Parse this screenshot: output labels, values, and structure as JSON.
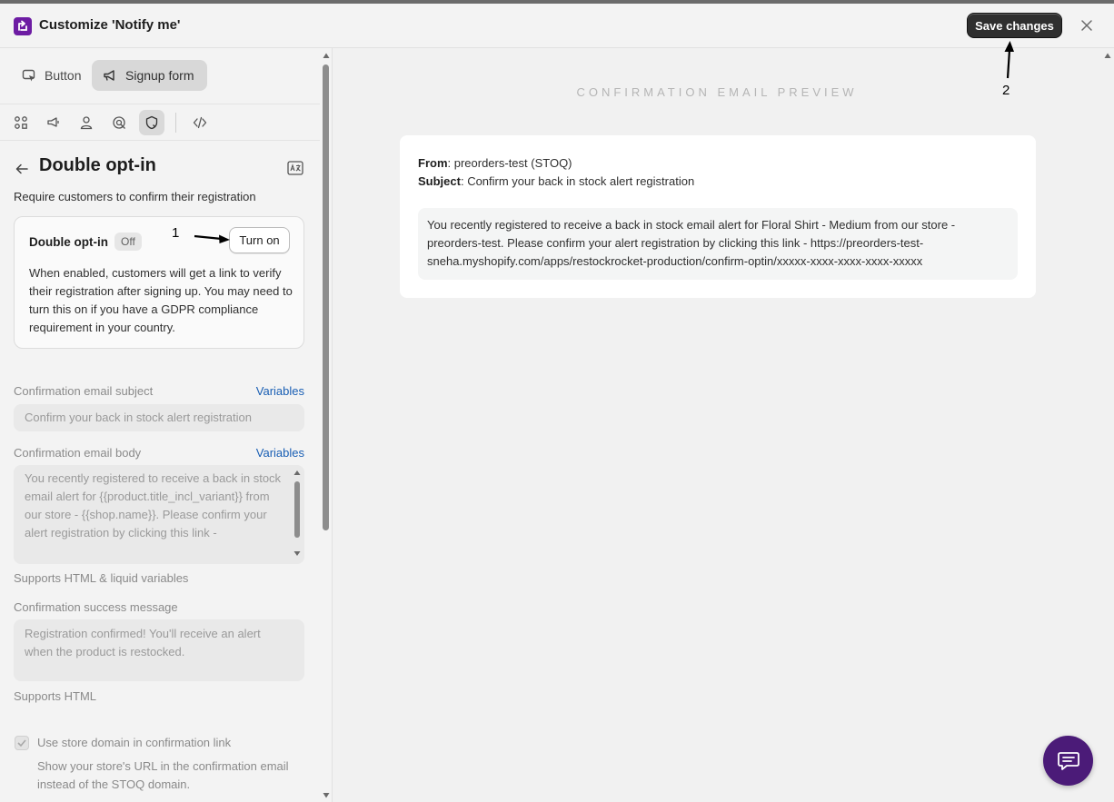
{
  "header": {
    "title": "Customize 'Notify me'",
    "save_label": "Save changes",
    "app_logo_icon": "app-logo-icon",
    "close_icon": "close-icon"
  },
  "left_panel": {
    "tabs": [
      {
        "label": "Button",
        "icon": "cursor-click-icon",
        "active": false
      },
      {
        "label": "Signup form",
        "icon": "megaphone-icon",
        "active": true
      }
    ],
    "section_icons": [
      "layout-blocks-icon",
      "megaphone-icon",
      "person-icon",
      "target-icon",
      "shield-icon",
      "code-icon"
    ],
    "active_section_icon": "shield-icon",
    "section": {
      "title": "Double opt-in",
      "subtitle": "Require customers to confirm their registration",
      "translate_icon": "translate-icon"
    },
    "double_optin_card": {
      "label": "Double opt-in",
      "status_badge": "Off",
      "turn_on_label": "Turn on",
      "description": "When enabled, customers will get a link to verify their registration after signing up. You may need to turn this on if you have a GDPR compliance requirement in your country."
    },
    "subject_field": {
      "label": "Confirmation email subject",
      "variables_link": "Variables",
      "value": "Confirm your back in stock alert registration"
    },
    "body_field": {
      "label": "Confirmation email body",
      "variables_link": "Variables",
      "value": "You recently registered to receive a back in stock email alert for {{product.title_incl_variant}} from our store - {{shop.name}}. Please confirm your alert registration by clicking this link -",
      "help": "Supports HTML & liquid variables"
    },
    "success_field": {
      "label": "Confirmation success message",
      "value": "Registration confirmed! You'll receive an alert when the product is restocked.",
      "help": "Supports HTML"
    },
    "store_domain_option": {
      "label": "Use store domain in confirmation link",
      "description": "Show your store's URL in the confirmation email instead of the STOQ domain.",
      "checked": true,
      "disabled": true
    }
  },
  "preview": {
    "heading": "CONFIRMATION EMAIL PREVIEW",
    "from_label": "From",
    "from_value": ": preorders-test (STOQ)",
    "subject_label": "Subject",
    "subject_value": ": Confirm your back in stock alert registration",
    "body": "You recently registered to receive a back in stock email alert for Floral Shirt - Medium from our store - preorders-test. Please confirm your alert registration by clicking this link - https://preorders-test-sneha.myshopify.com/apps/restockrocket-production/confirm-optin/xxxxx-xxxx-xxxx-xxxx-xxxxx"
  },
  "annotations": {
    "marker_1": "1",
    "marker_2": "2"
  },
  "colors": {
    "brand": "#6d1ca3",
    "chat_fab": "#4b1b78",
    "link": "#1a5fb4",
    "primary_button": "#2f2f2f"
  }
}
